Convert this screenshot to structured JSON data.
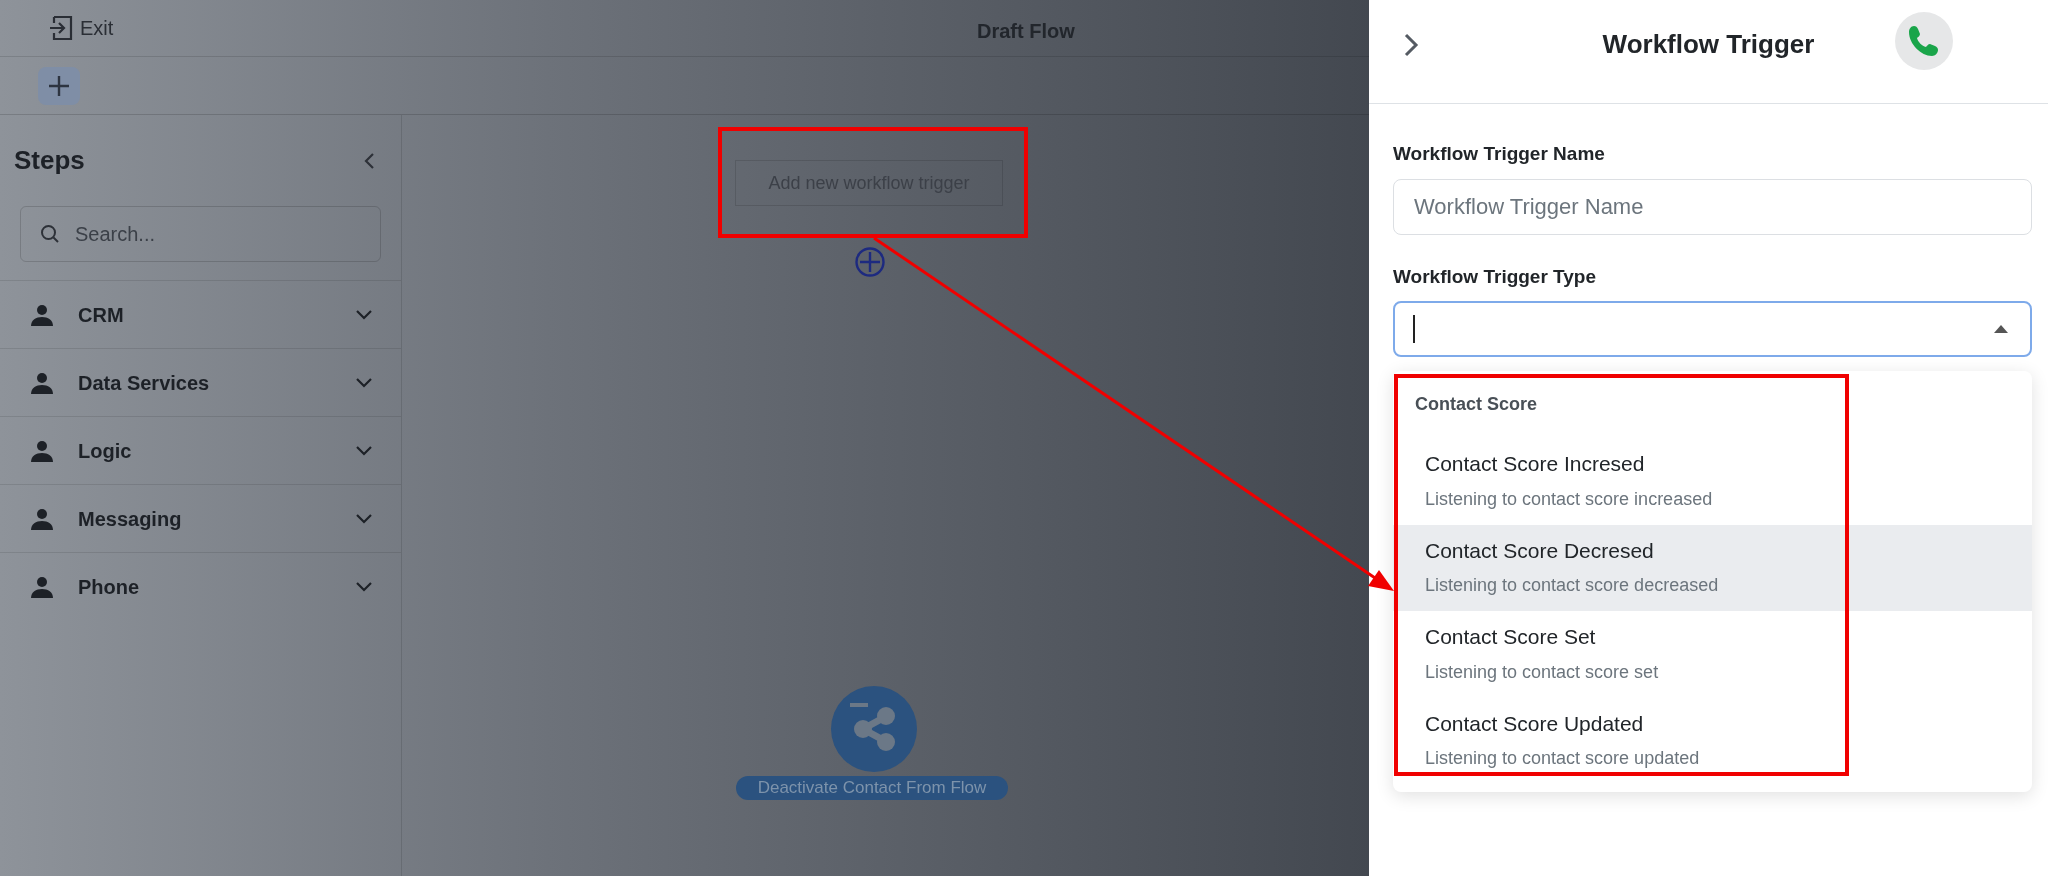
{
  "top_bar": {
    "exit_label": "Exit",
    "title": "Draft Flow"
  },
  "steps_panel": {
    "title": "Steps",
    "search": {
      "placeholder": "Search..."
    },
    "categories": [
      {
        "label": "CRM",
        "expanded": false
      },
      {
        "label": "Data Services",
        "expanded": false
      },
      {
        "label": "Logic",
        "expanded": false
      },
      {
        "label": "Messaging",
        "expanded": false
      },
      {
        "label": "Phone",
        "expanded": false
      }
    ]
  },
  "canvas": {
    "trigger_placeholder": "Add new workflow trigger",
    "nodes": [
      {
        "label": "Deactivate Contact From Flow"
      }
    ]
  },
  "drawer": {
    "title": "Workflow Trigger",
    "fields": [
      {
        "label": "Workflow Trigger Name",
        "kind": "text",
        "placeholder": "Workflow Trigger Name"
      },
      {
        "label": "Workflow Trigger Type",
        "kind": "select",
        "focused": true,
        "open": true
      }
    ],
    "dropdown": {
      "group": "Contact Score",
      "options": [
        {
          "title": "Contact Score Incresed",
          "description": "Listening to contact score increased",
          "highlighted": false
        },
        {
          "title": "Contact Score Decresed",
          "description": "Listening to contact score decreased",
          "highlighted": true
        },
        {
          "title": "Contact Score Set",
          "description": "Listening to contact score set",
          "highlighted": false
        },
        {
          "title": "Contact Score Updated",
          "description": "Listening to contact score updated",
          "highlighted": false
        }
      ]
    }
  }
}
